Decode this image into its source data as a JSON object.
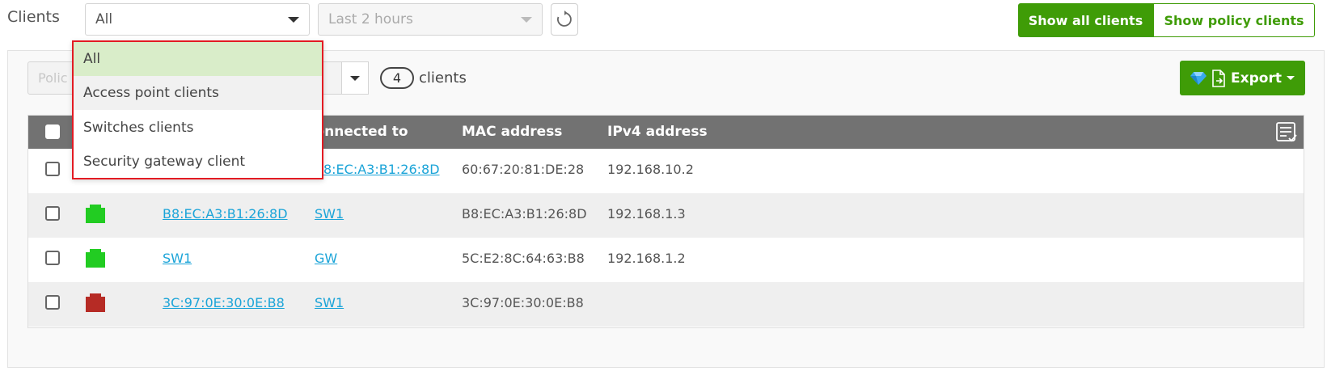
{
  "header": {
    "title": "Clients",
    "client_type_select": {
      "value": "All"
    },
    "time_range_select": {
      "value": "Last 2 hours"
    },
    "show_all_label": "Show all clients",
    "show_policy_label": "Show policy clients"
  },
  "toolbar": {
    "policy_select_value": "Polic",
    "client_count": "4",
    "client_count_label": "clients",
    "export_label": "Export"
  },
  "table": {
    "columns": [
      "Connected to",
      "MAC address",
      "IPv4 address"
    ],
    "rows": [
      {
        "status": "online",
        "name": "",
        "connected_to": "B8:EC:A3:B1:26:8D",
        "mac": "60:67:20:81:DE:28",
        "ipv4": "192.168.10.2"
      },
      {
        "status": "online",
        "name": "B8:EC:A3:B1:26:8D",
        "connected_to": "SW1",
        "mac": "B8:EC:A3:B1:26:8D",
        "ipv4": "192.168.1.3"
      },
      {
        "status": "online",
        "name": "SW1",
        "connected_to": "GW",
        "mac": "5C:E2:8C:64:63:B8",
        "ipv4": "192.168.1.2"
      },
      {
        "status": "offline",
        "name": "3C:97:0E:30:0E:B8",
        "connected_to": "SW1",
        "mac": "3C:97:0E:30:0E:B8",
        "ipv4": ""
      }
    ]
  },
  "dropdown": {
    "items": [
      "All",
      "Access point clients",
      "Switches clients",
      "Security gateway client"
    ],
    "selected": "All",
    "hovered": "Access point clients"
  },
  "colors": {
    "accent_green": "#3f9c07",
    "online": "#22cc22",
    "offline": "#b62b25",
    "link": "#1ba4d8",
    "highlight_border": "#e31b23"
  },
  "icons": {
    "refresh": "refresh-icon",
    "export_gem": "gem-icon",
    "export_file": "file-export-icon",
    "column_settings": "column-settings-icon",
    "status": "ethernet-port-icon"
  }
}
